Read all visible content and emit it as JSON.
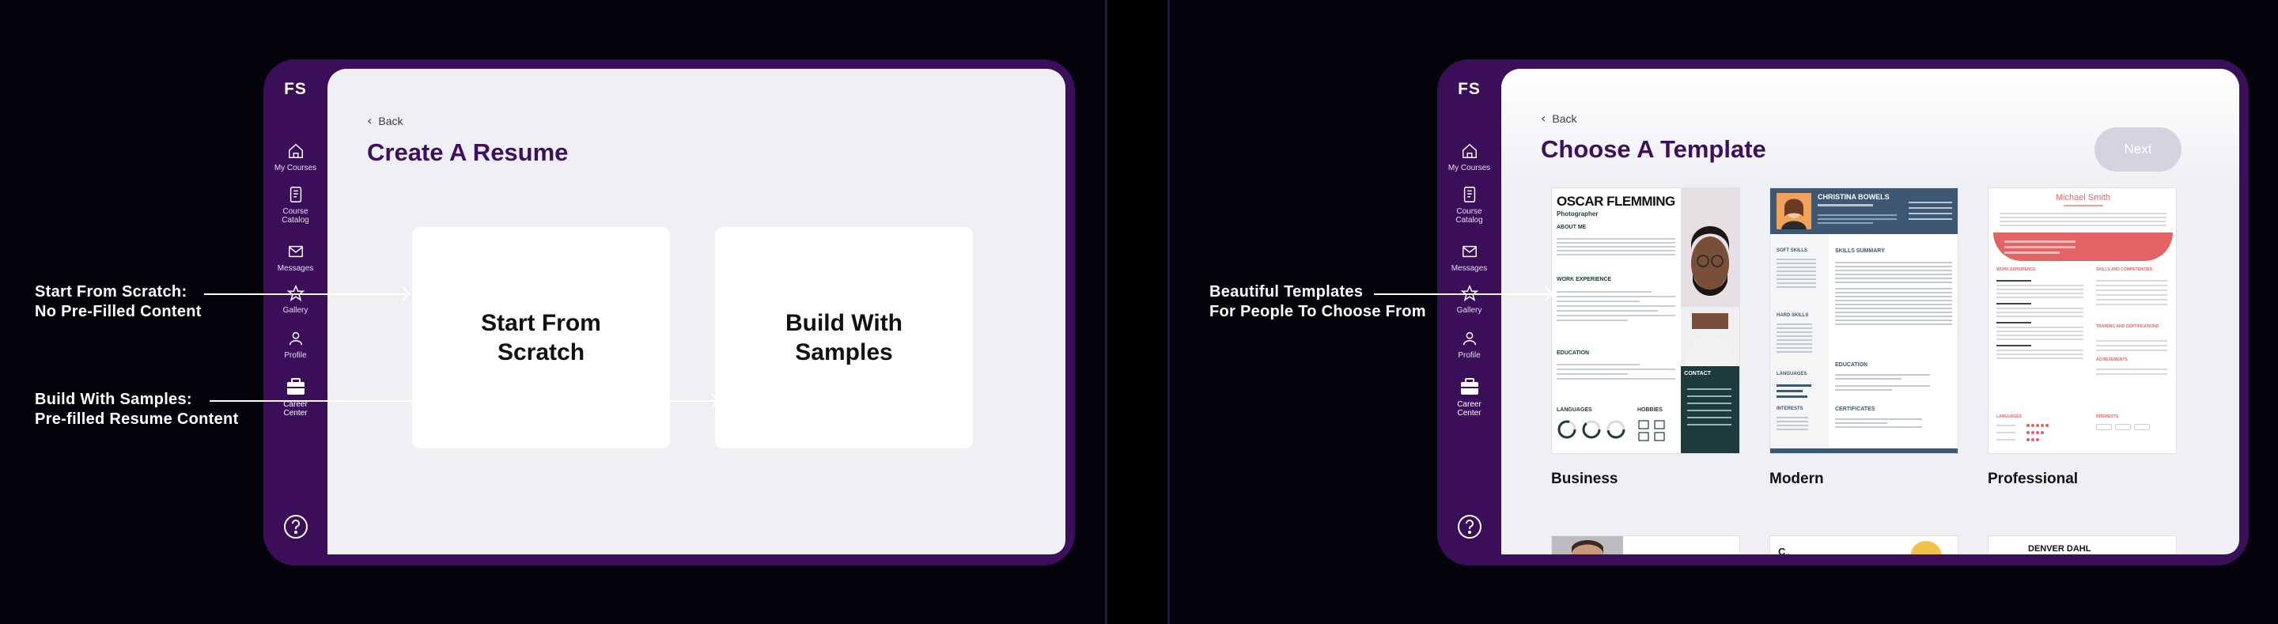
{
  "sidebar": {
    "logo": "FS",
    "items": [
      {
        "label": "My Courses",
        "icon": "home-icon"
      },
      {
        "label": "Course Catalog",
        "icon": "book-icon"
      },
      {
        "label": "Messages",
        "icon": "mail-icon"
      },
      {
        "label": "Gallery",
        "icon": "star-icon"
      },
      {
        "label": "Profile",
        "icon": "person-icon"
      },
      {
        "label": "Career Center",
        "icon": "briefcase-icon"
      }
    ],
    "help_icon": "help-icon"
  },
  "left": {
    "back_label": "Back",
    "title": "Create A Resume",
    "cards": [
      {
        "label": "Start From Scratch"
      },
      {
        "label": "Build With Samples"
      }
    ],
    "annotations": [
      {
        "line1": "Start From Scratch:",
        "line2": "No Pre-Filled Content"
      },
      {
        "line1": "Build With Samples:",
        "line2": "Pre-filled Resume Content"
      }
    ]
  },
  "right": {
    "back_label": "Back",
    "title": "Choose A Template",
    "next_label": "Next",
    "annotation": {
      "line1": "Beautiful Templates",
      "line2": "For People To Choose From"
    },
    "templates": [
      {
        "label": "Business",
        "name": "OSCAR FLEMMING",
        "role": "Photographer",
        "sections": [
          "ABOUT ME",
          "WORK EXPERIENCE",
          "EDUCATION",
          "LANGUAGES",
          "HOBBIES",
          "CONTACT"
        ]
      },
      {
        "label": "Modern",
        "name": "CHRISTINA BOWELS",
        "sections": [
          "SOFT SKILLS",
          "SKILLS SUMMARY",
          "HARD SKILLS",
          "EDUCATION",
          "LANGUAGES",
          "INTERESTS",
          "CERTIFICATES"
        ]
      },
      {
        "label": "Professional",
        "name": "Michael Smith",
        "sections": [
          "WORK EXPERIENCE",
          "SKILLS AND COMPETENCIES",
          "TRAINING AND CERTIFICATIONS",
          "ACHIEVEMENTS",
          "LANGUAGES",
          "INTERESTS"
        ]
      }
    ],
    "partial_name": "DENVER DAHL"
  },
  "colors": {
    "brand_purple": "#3b0e5a",
    "title_purple": "#3f0f5f",
    "teal_dark": "#1d3a3d",
    "slate": "#3e5873",
    "coral": "#e26363"
  }
}
